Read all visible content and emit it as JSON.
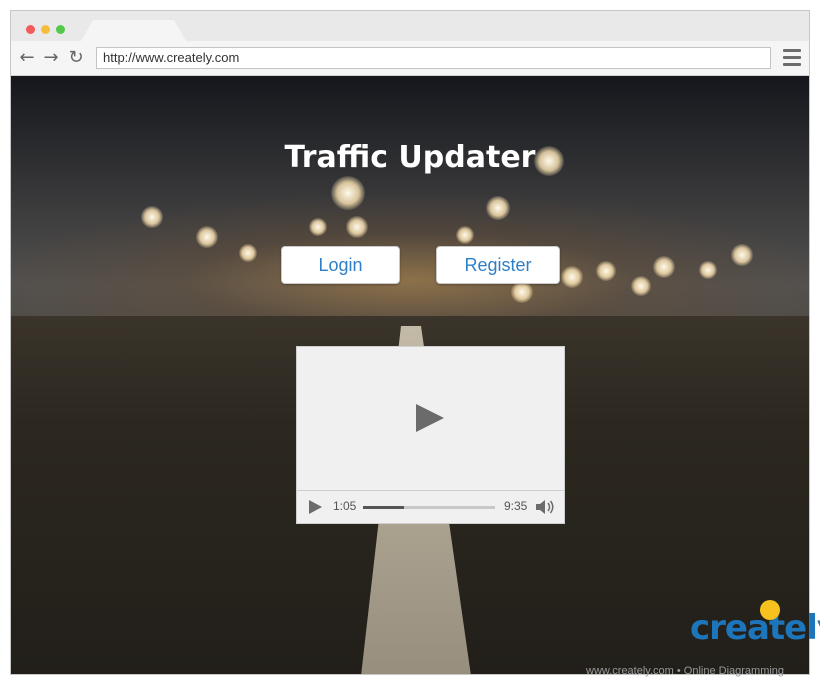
{
  "browser": {
    "url": "http://www.creately.com",
    "icons": {
      "back": "arrow-left-icon",
      "forward": "arrow-right-icon",
      "reload": "reload-icon",
      "menu": "hamburger-menu-icon"
    }
  },
  "page": {
    "title": "Traffic Updater",
    "login_label": "Login",
    "register_label": "Register"
  },
  "video": {
    "current_time": "1:05",
    "total_time": "9:35",
    "progress": 0.31,
    "icons": {
      "big_play": "play-icon",
      "small_play": "play-icon",
      "volume": "volume-icon"
    }
  },
  "watermark": {
    "logo": "creately",
    "caption": "www.creately.com • Online Diagramming"
  },
  "colors": {
    "accent": "#2f7fc6",
    "logo": "#1d75bc"
  }
}
